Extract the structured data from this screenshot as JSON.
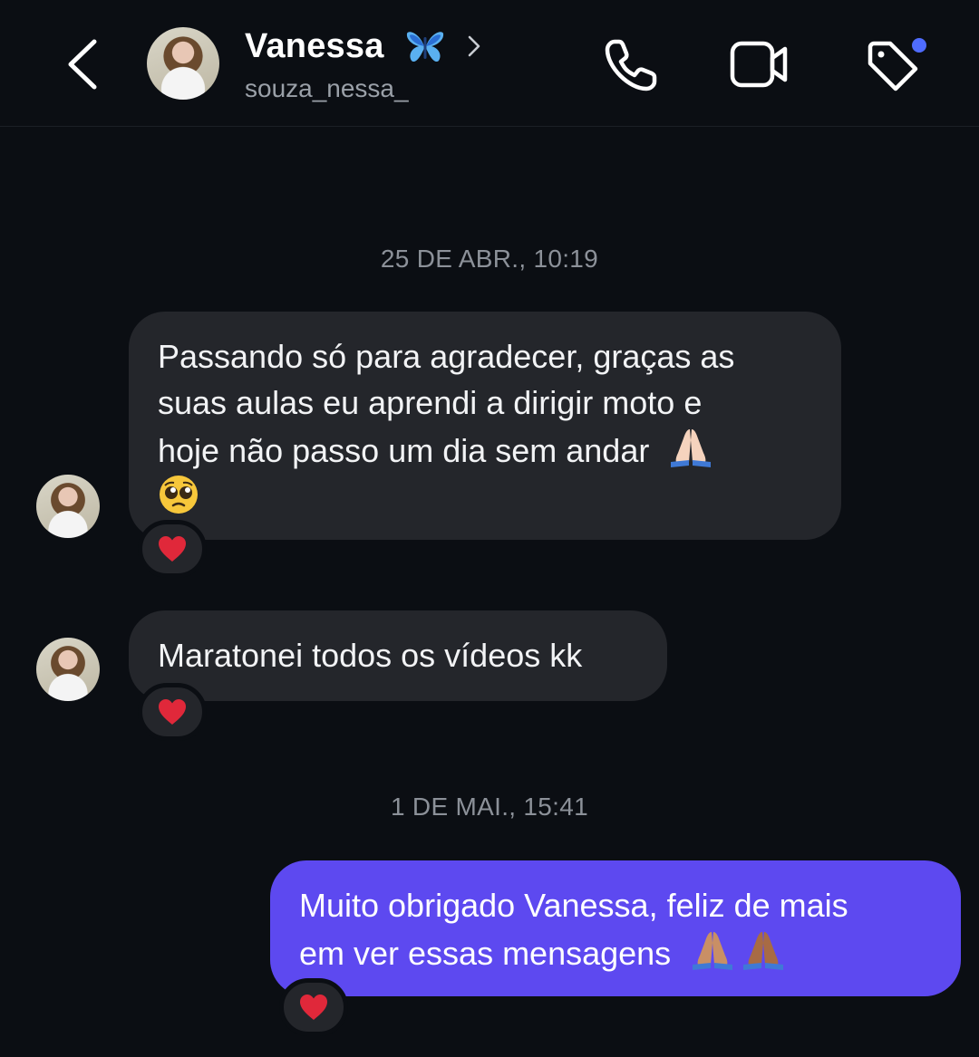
{
  "header": {
    "contact_name": "Vanessa",
    "username": "souza_nessa_",
    "icons": {
      "back": "chevron-left-icon",
      "verified_decor": "butterfly-emoji",
      "profile_chevron": "chevron-right-icon",
      "call": "phone-icon",
      "video": "video-camera-icon",
      "label": "tag-icon"
    },
    "accent_dot_color": "#4f6cff"
  },
  "thread": {
    "date_1": "25 DE ABR., 10:19",
    "date_2": "1 DE MAI., 15:41",
    "messages": [
      {
        "direction": "received",
        "lines": [
          "Passando só para agradecer, graças as",
          "suas aulas eu aprendi a dirigir moto e",
          "hoje não passo um dia sem andar"
        ],
        "trailing_emoji": [
          "folded-hands-emoji",
          "pleading-face-emoji"
        ],
        "reaction": "red-heart-emoji"
      },
      {
        "direction": "received",
        "lines": [
          "Maratonei todos os vídeos kk"
        ],
        "reaction": "red-heart-emoji"
      },
      {
        "direction": "sent",
        "lines": [
          "Muito obrigado Vanessa, feliz de mais",
          "em ver essas mensagens"
        ],
        "trailing_emoji": [
          "folded-hands-emoji",
          "folded-hands-emoji"
        ],
        "reaction": "red-heart-emoji"
      }
    ]
  },
  "colors": {
    "background": "#0b0e13",
    "received_bubble": "#24262b",
    "sent_bubble": "#5d49f0",
    "date_text": "#8c9199",
    "reaction_heart": "#e0283a"
  }
}
